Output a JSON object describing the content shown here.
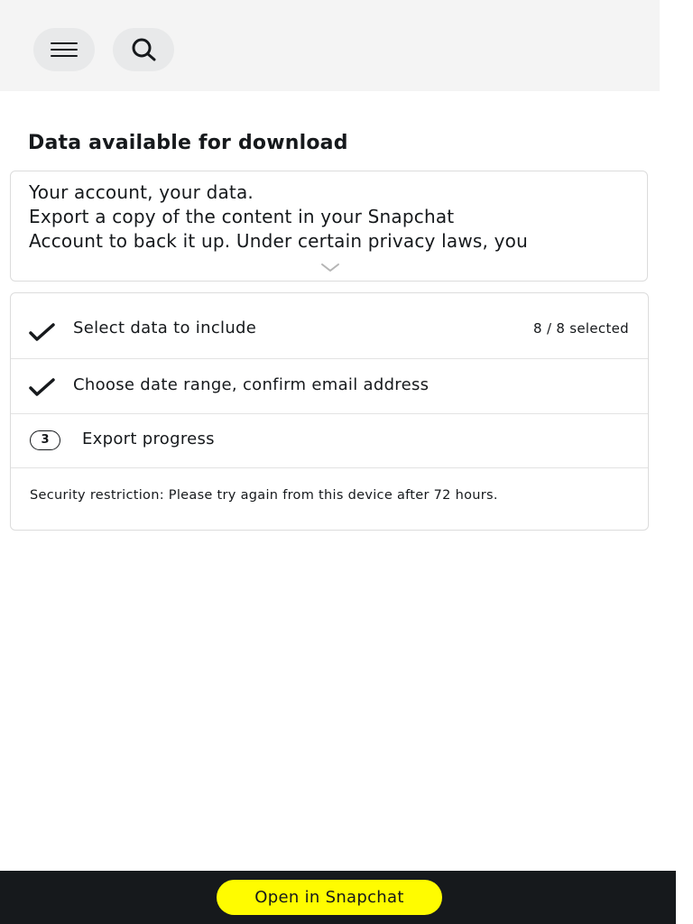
{
  "header": {
    "menu_icon": "hamburger-menu-icon",
    "search_icon": "search-icon"
  },
  "download": {
    "title": "Data available for download",
    "intro_lines": [
      "Your account, your data.",
      "Export a copy of the content in your Snapchat",
      "Account to back it up. Under certain privacy laws, you"
    ],
    "expand_icon": "chevron-down-icon",
    "steps": [
      {
        "status": "complete",
        "icon": "check-icon",
        "label": "Select data to include",
        "count": "8 / 8 selected"
      },
      {
        "status": "complete",
        "icon": "check-icon",
        "label": "Choose date range, confirm email address"
      },
      {
        "status": "current",
        "number": "3",
        "label": "Export progress"
      }
    ],
    "restriction": "Security restriction: Please try again from this device after 72 hours."
  },
  "footer": {
    "open_button": "Open in Snapchat",
    "button_color": "#fffc00",
    "bar_color": "#16191c"
  }
}
